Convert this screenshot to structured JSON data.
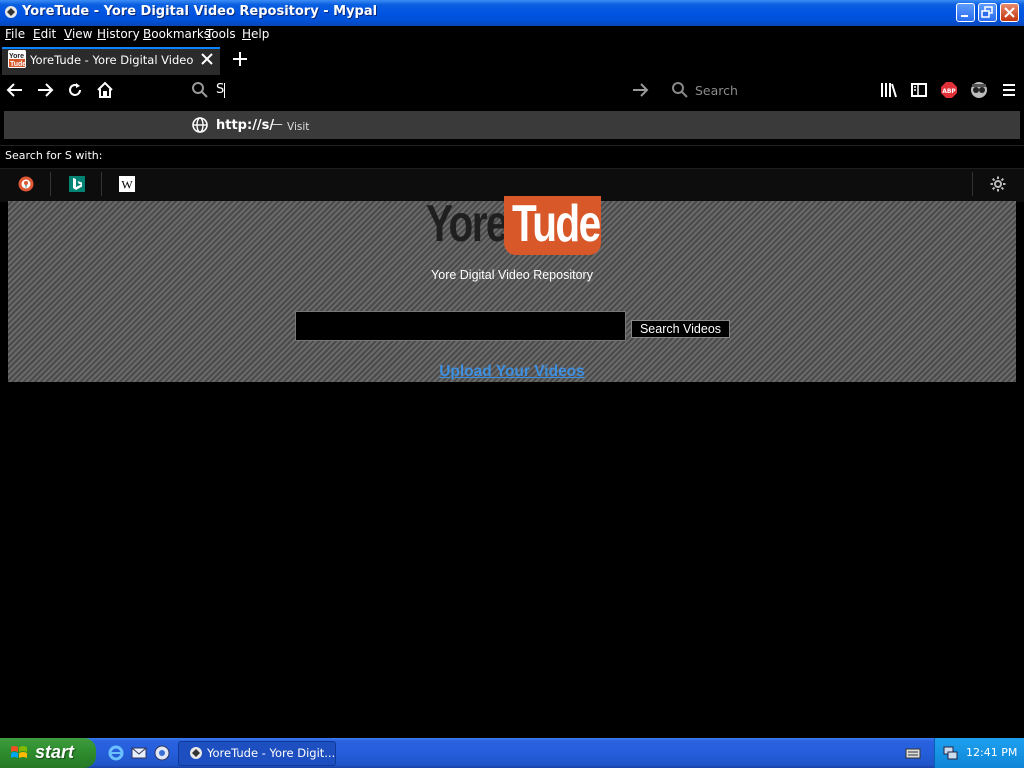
{
  "window": {
    "title": "YoreTude - Yore Digital Video Repository - Mypal"
  },
  "menubar": {
    "items": [
      {
        "label": "File",
        "accel": "F",
        "rest": "ile"
      },
      {
        "label": "Edit",
        "accel": "E",
        "rest": "dit"
      },
      {
        "label": "View",
        "accel": "V",
        "rest": "iew"
      },
      {
        "label": "History",
        "accel": "H",
        "rest": "istory"
      },
      {
        "label": "Bookmarks",
        "accel": "B",
        "rest": "ookmarks"
      },
      {
        "label": "Tools",
        "accel": "T",
        "rest": "ools"
      },
      {
        "label": "Help",
        "accel": "H",
        "rest": "elp"
      }
    ]
  },
  "tabs": [
    {
      "title": "YoreTude - Yore Digital Video Repository",
      "favicon": "yoretude-favicon",
      "active": true
    }
  ],
  "toolbar": {
    "urlbar_value": "S",
    "search_placeholder": "Search",
    "icons": [
      "back-icon",
      "forward-icon",
      "reload-icon",
      "home-icon",
      "library-icon",
      "sidebar-icon",
      "adblock-icon",
      "privacy-icon",
      "menu-icon"
    ],
    "adblock_label": "ABP"
  },
  "url_dropdown": {
    "url": "http://s/",
    "separator": "—",
    "action": "Visit",
    "search_for": "Search for S with:",
    "engines": [
      "duckduckgo-icon",
      "bing-icon",
      "wikipedia-icon"
    ],
    "wikipedia_glyph": "W"
  },
  "page": {
    "logo_part1": "Yore",
    "logo_part2": "Tude",
    "tagline": "Yore Digital Video Repository",
    "search_input_value": "",
    "search_button": "Search Videos",
    "upload_link": "Upload Your Videos"
  },
  "taskbar": {
    "start_label": "start",
    "task_button": "YoreTude - Yore Digit...",
    "clock": "12:41 PM"
  },
  "colors": {
    "titlebar": "#0054e3",
    "logo_red": "#d8582a",
    "link_blue": "#3d8fe0",
    "start_green": "#2f8f2f"
  }
}
